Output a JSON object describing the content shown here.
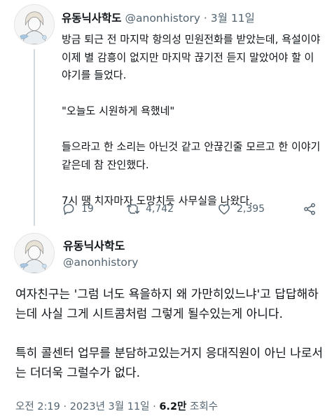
{
  "tweet1": {
    "author_name": "유동닉사학도",
    "handle": "@anonhistory",
    "separator": "·",
    "date": "3월 11일",
    "paragraphs": [
      "방금 퇴근 전 마지막 항의성 민원전화를 받았는데, 욕설이야 이제 별 감흥이 없지만 마지막 끊기전 듣지 말았어야 할 이야기를 들었다.",
      "\"오늘도 시원하게 욕했네\"",
      "들으라고 한 소리는 아닌것 같고 안끊긴줄 모르고 한 이야기 같은데 참 잔인했다.",
      "7시 땡 치자마자 도망치듯 사무실을 나왔다."
    ],
    "stats": {
      "replies": "19",
      "retweets": "4,742",
      "likes": "2,395"
    },
    "icons": [
      "reply-icon",
      "retweet-icon",
      "like-icon",
      "share-icon"
    ]
  },
  "tweet2": {
    "author_name": "유동닉사학도",
    "handle": "@anonhistory",
    "paragraphs": [
      "여자친구는 '그럼 너도 욕을하지 왜 가만히있느냐'고 답답해하는데 사실 그게 시트콤처럼 그렇게 될수있는게 아니다.",
      "특히 콜센터 업무를 분담하고있는거지 응대직원이 아닌 나로서는 더더욱 그럴수가 없다."
    ],
    "time": "오전 2:19",
    "separator": "·",
    "date": "2023년 3월 11일",
    "views_count": "6.2만",
    "views_label": "조회수"
  },
  "colors": {
    "text": "#0f1419",
    "muted": "#536471",
    "thread_line": "#cfd9de"
  }
}
